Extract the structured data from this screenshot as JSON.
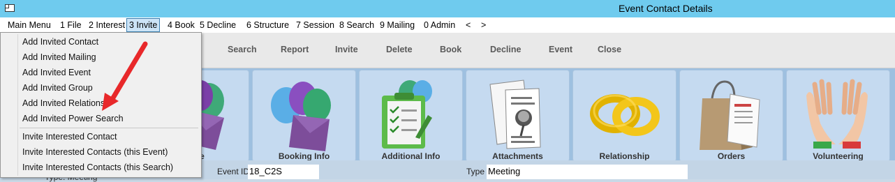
{
  "window": {
    "title": "Event Contact Details"
  },
  "menubar": {
    "items": [
      {
        "label": "Main Menu"
      },
      {
        "label": "1 File"
      },
      {
        "label": "2 Interest"
      },
      {
        "label": "3 Invite"
      },
      {
        "label": "4 Book"
      },
      {
        "label": "5 Decline"
      },
      {
        "label": "6 Structure"
      },
      {
        "label": "7 Session"
      },
      {
        "label": "8 Search"
      },
      {
        "label": "9 Mailing"
      },
      {
        "label": "0 Admin"
      },
      {
        "label": "<"
      },
      {
        "label": ">"
      }
    ]
  },
  "dropdown": {
    "items": [
      {
        "label": "Add Invited Contact"
      },
      {
        "label": "Add Invited Mailing"
      },
      {
        "label": "Add Invited Event"
      },
      {
        "label": "Add Invited Group"
      },
      {
        "label": "Add Invited Relations"
      },
      {
        "label": "Add Invited Power Search"
      },
      {
        "label": "Invite Interested Contact"
      },
      {
        "label": "Invite Interested Contacts (this Event)"
      },
      {
        "label": "Invite Interested Contacts (this Search)"
      }
    ]
  },
  "toolbar": {
    "buttons": [
      {
        "label": "Search"
      },
      {
        "label": "Report"
      },
      {
        "label": "Invite"
      },
      {
        "label": "Delete"
      },
      {
        "label": "Book"
      },
      {
        "label": "Decline"
      },
      {
        "label": "Event"
      },
      {
        "label": "Close"
      }
    ]
  },
  "tiles": [
    {
      "label": "dee",
      "icon": "attendee-balloons-icon"
    },
    {
      "label": "Booking Info",
      "icon": "balloons-envelope-icon"
    },
    {
      "label": "Additional Info",
      "icon": "clipboard-checklist-icon"
    },
    {
      "label": "Attachments",
      "icon": "documents-pushpin-icon"
    },
    {
      "label": "Relationship",
      "icon": "wedding-rings-icon"
    },
    {
      "label": "Orders",
      "icon": "shopping-bag-icon"
    },
    {
      "label": "Volunteering",
      "icon": "raised-hands-icon"
    }
  ],
  "fields": {
    "event_id": {
      "label": "Event ID",
      "value": "18_C2S"
    },
    "type": {
      "label": "Type",
      "value": "Meeting"
    },
    "partial_left": "Type: Meeting"
  },
  "colors": {
    "titlebar": "#6fcbee",
    "tile_bg": "#c5daf0",
    "arrow": "#e8282a"
  }
}
